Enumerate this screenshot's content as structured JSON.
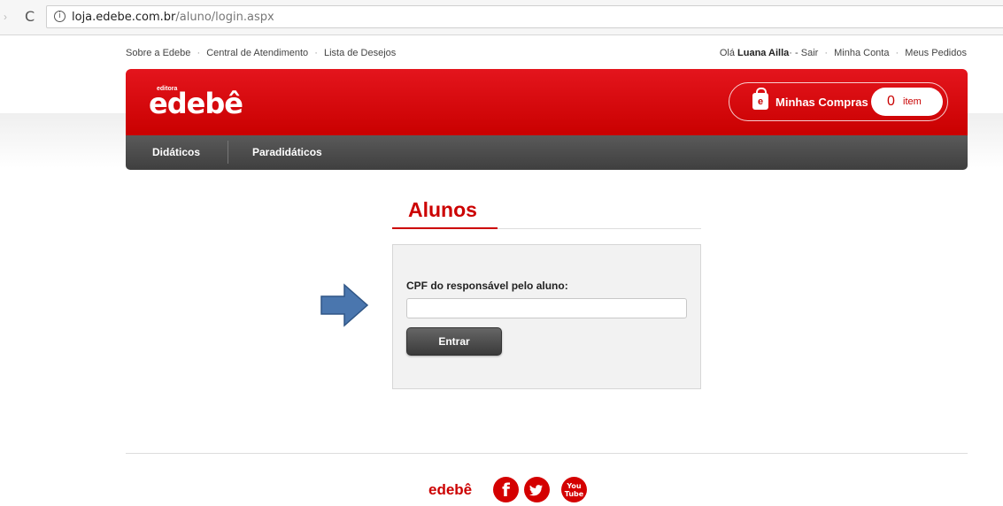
{
  "browser": {
    "back": "›",
    "reload": "C",
    "info": "i",
    "url_domain": "loja.edebe.com.br",
    "url_path": "/aluno/login.aspx"
  },
  "top_links": {
    "items": [
      "Sobre a Edebe",
      "Central de Atendimento",
      "Lista de Desejos"
    ],
    "separator": "·"
  },
  "user_links": {
    "greeting": "Olá",
    "user_name": "Luana Ailla",
    "after_name": "·",
    "sair": "- Sair",
    "minha_conta": "Minha Conta",
    "meus_pedidos": "Meus Pedidos",
    "separator": "·"
  },
  "header": {
    "logo_small": "editora",
    "logo": "edebê",
    "cart_icon_letter": "e",
    "cart_label": "Minhas Compras",
    "cart_count": "0",
    "cart_item_label": "item"
  },
  "nav": {
    "items": [
      "Didáticos",
      "Paradidáticos"
    ]
  },
  "login": {
    "title": "Alunos",
    "cpf_label": "CPF do responsável pelo aluno:",
    "cpf_value": "",
    "submit_label": "Entrar"
  },
  "footer": {
    "logo": "edebê",
    "facebook_icon": "f",
    "youtube_icon_top": "You",
    "youtube_icon_bottom": "Tube"
  },
  "colors": {
    "brand_red": "#cc0000",
    "nav_dark": "#4a4a4a",
    "arrow_blue": "#4a76ae"
  }
}
